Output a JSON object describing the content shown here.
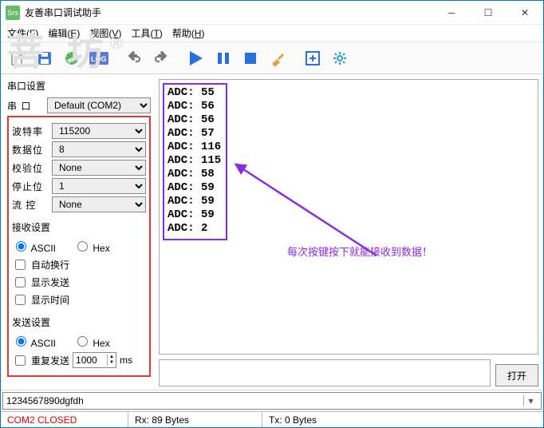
{
  "window": {
    "title": "友善串口调试助手"
  },
  "menu": {
    "file": "文件",
    "file_k": "F",
    "edit": "编辑",
    "edit_k": "E",
    "view": "视图",
    "view_k": "V",
    "tool": "工具",
    "tool_k": "T",
    "help": "帮助",
    "help_k": "H"
  },
  "toolbar_icons": [
    "doc",
    "save",
    "globe",
    "log",
    "undo",
    "redo",
    "play",
    "pause",
    "stop",
    "brush",
    "addbox",
    "gear"
  ],
  "serial": {
    "section": "串口设置",
    "port_label": "串  口",
    "port_value": "Default (COM2)",
    "baud_label": "波特率",
    "baud_value": "115200",
    "databits_label": "数据位",
    "databits_value": "8",
    "parity_label": "校验位",
    "parity_value": "None",
    "stopbits_label": "停止位",
    "stopbits_value": "1",
    "flow_label": "流  控",
    "flow_value": "None"
  },
  "recv": {
    "section": "接收设置",
    "ascii": "ASCII",
    "hex": "Hex",
    "ascii_checked": true,
    "autowrap": "自动换行",
    "autowrap_checked": false,
    "showsend": "显示发送",
    "showsend_checked": false,
    "showtime": "显示时间",
    "showtime_checked": false
  },
  "send": {
    "section": "发送设置",
    "ascii": "ASCII",
    "hex": "Hex",
    "ascii_checked": true,
    "repeat": "重复发送",
    "repeat_checked": false,
    "interval": "1000",
    "unit": "ms"
  },
  "output_lines": [
    "ADC: 55",
    "ADC: 56",
    "ADC: 56",
    "ADC: 57",
    "ADC: 116",
    "ADC: 115",
    "ADC: 58",
    "ADC: 59",
    "ADC: 59",
    "ADC: 59",
    "ADC: 2"
  ],
  "annotation": "每次按键按下就能接收到数据！",
  "open_button": "打开",
  "input_value": "1234567890dgfdh",
  "status": {
    "port": "COM2 CLOSED",
    "rx": "Rx: 89 Bytes",
    "tx": "Tx: 0 Bytes"
  },
  "watermark": "菩  坊",
  "watermark_sub": "®"
}
